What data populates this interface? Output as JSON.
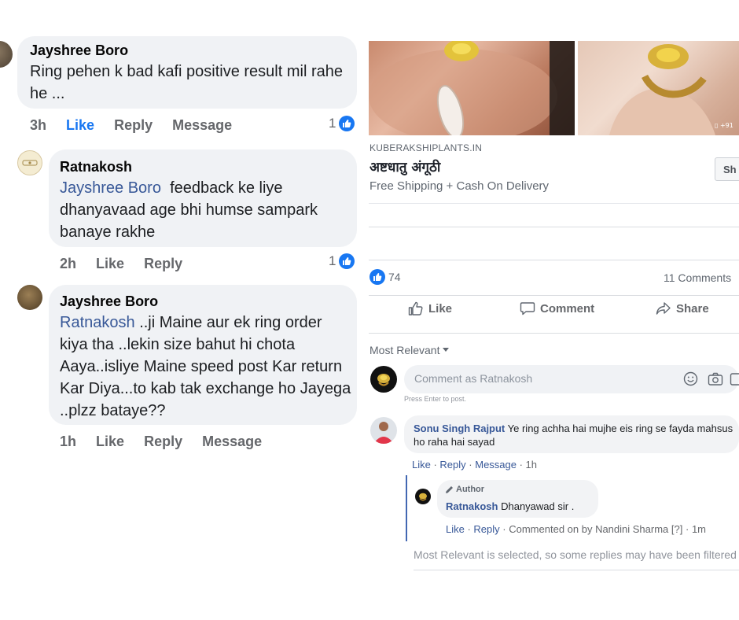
{
  "left_comments": [
    {
      "name": "Jayshree Boro",
      "text": "Ring pehen k bad kafi positive result mil rahe he ...",
      "time": "3h",
      "like": "Like",
      "reply": "Reply",
      "message": "Message",
      "reaction_count": "1"
    },
    {
      "name": "Ratnakosh",
      "mention": "Jayshree Boro",
      "text": "feedback ke liye dhanyavaad age bhi humse sampark banaye rakhe",
      "time": "2h",
      "like": "Like",
      "reply": "Reply",
      "reaction_count": "1"
    },
    {
      "name": "Jayshree Boro",
      "mention": "Ratnakosh",
      "text": "..ji Maine aur ek ring order kiya tha ..lekin size bahut hi chota Aaya..isliye Maine speed post Kar return Kar Diya...to kab tak exchange ho Jayega ..plzz bataye??",
      "time": "1h",
      "like": "Like",
      "reply": "Reply",
      "message": "Message"
    }
  ],
  "post": {
    "link_domain": "KUBERAKSHIPLANTS.IN",
    "link_title": "अष्टधातु अंगूठी",
    "link_subtitle": "Free Shipping + Cash On Delivery",
    "shop_button": "Sh",
    "likes_count": "74",
    "comments_count": "11 Comments",
    "actions": {
      "like": "Like",
      "comment": "Comment",
      "share": "Share"
    },
    "sort_label": "Most Relevant",
    "comment_placeholder": "Comment as Ratnakosh",
    "press_enter": "Press Enter to post.",
    "comment": {
      "name": "Sonu Singh Rajput",
      "text": "Ye ring achha hai mujhe eis ring se fayda mahsus ho raha hai sayad",
      "meta": {
        "like": "Like",
        "reply": "Reply",
        "message": "Message",
        "time": "1h"
      }
    },
    "reply": {
      "badge": "Author",
      "name": "Ratnakosh",
      "text": "Dhanyawad sir .",
      "meta": {
        "like": "Like",
        "reply": "Reply",
        "commented_on": "Commented on by Nandini Sharma",
        "q": "[?]",
        "time": "1m"
      }
    },
    "footer_note": "Most Relevant is selected, so some replies may have been filtered out."
  },
  "colors": {
    "facebook_blue": "#1877f2",
    "link_blue": "#385898",
    "bubble_grey": "#f0f2f5",
    "meta_grey": "#65676b"
  }
}
